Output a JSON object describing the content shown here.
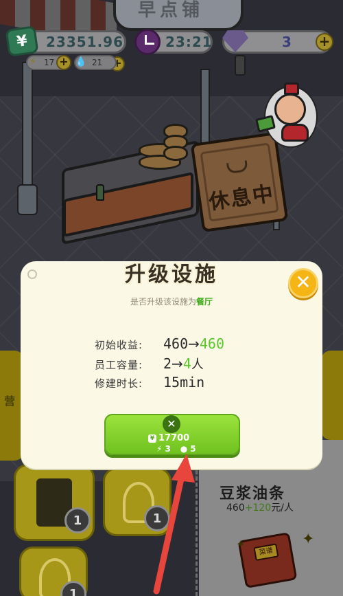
{
  "hud": {
    "money": "23351.96",
    "time": "23:21",
    "gems": "3",
    "energy": "17",
    "water": "21"
  },
  "scene": {
    "shop_sign": "早点铺",
    "board_text": "休息中",
    "left_strip_text": "营"
  },
  "dialog": {
    "title": "升级设施",
    "subtitle_prefix": "是否升级该设施为",
    "subtitle_target": "餐厅",
    "stats": [
      {
        "label": "初始收益:",
        "from": "460",
        "to": "460"
      },
      {
        "label": "员工容量:",
        "from": "2",
        "to": "4",
        "unit": "人"
      },
      {
        "label": "修建时长:",
        "value": "15min"
      }
    ],
    "button": {
      "cost_money": "17700",
      "cost_energy": "3",
      "cost_water": "5"
    }
  },
  "bottom": {
    "dish_name": "豆浆油条",
    "dish_base": "460",
    "dish_bonus": "+120",
    "dish_unit": "元/人",
    "badge_count": "1",
    "book_label": "菜谱"
  },
  "colors": {
    "accent_green": "#5ac82a",
    "close_yellow": "#f4b515",
    "button_green": "#7fd22a",
    "arrow_red": "#e8463c"
  }
}
